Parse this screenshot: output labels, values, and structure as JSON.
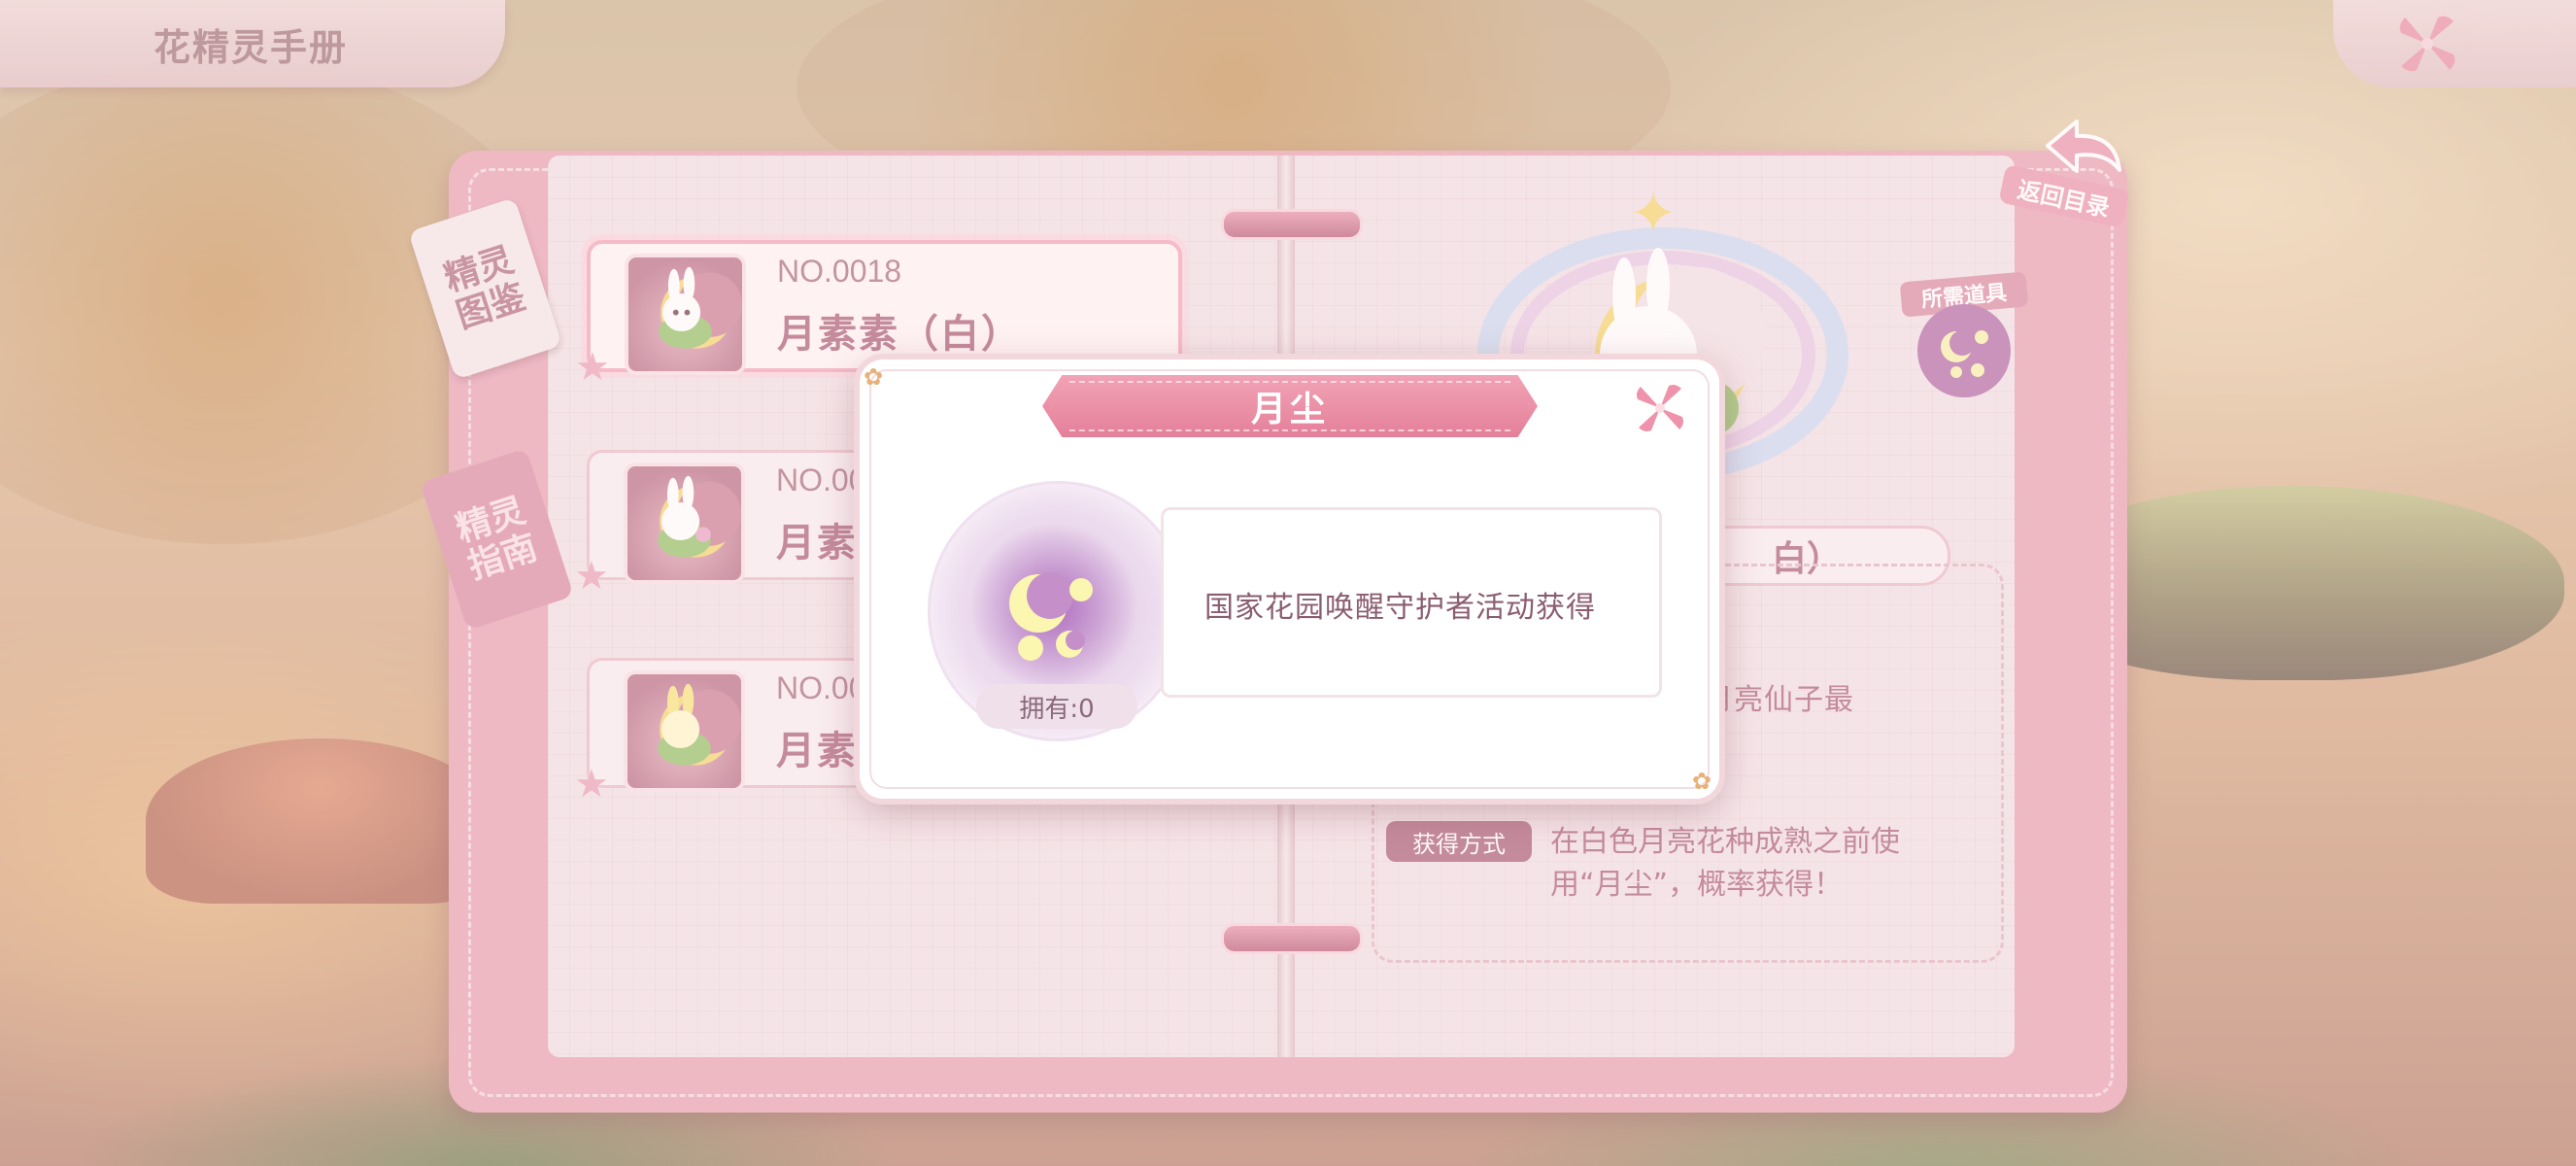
{
  "header": {
    "title": "花精灵手册"
  },
  "side_tabs": [
    {
      "label": "精灵图鉴",
      "active": true
    },
    {
      "label": "精灵指南",
      "active": false
    }
  ],
  "back_button": {
    "label": "返回目录"
  },
  "sprite_list": [
    {
      "no": "NO.0018",
      "name": "月素素（白）",
      "selected": true
    },
    {
      "no": "NO.00",
      "name": "月素",
      "selected": false
    },
    {
      "no": "NO.00",
      "name": "月素",
      "selected": false
    }
  ],
  "detail": {
    "required_item_label": "所需道具",
    "name_fragment": "白）",
    "description_fragment": "精华，是月亮仙子最",
    "obtain_label": "获得方式",
    "obtain_text": "在白色月亮花种成熟之前使用“月尘”，概率获得！"
  },
  "modal": {
    "title": "月尘",
    "source": "国家花园唤醒守护者活动获得",
    "owned": "拥有:0"
  },
  "colors": {
    "accent_pink": "#e48099",
    "text_mauve": "#a85c76"
  }
}
